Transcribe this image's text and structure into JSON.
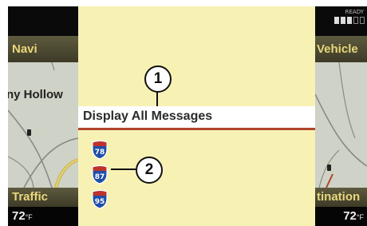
{
  "left_panel": {
    "navi_label": "Navi",
    "map_label": "ny Hollow",
    "traffic_label": "Traffic",
    "temp_value": "72",
    "temp_unit": "°F"
  },
  "right_panel": {
    "status_text": "READY",
    "vehicle_label": "Vehicle",
    "destination_label": "tination",
    "temp_value": "72",
    "temp_unit": "°F"
  },
  "overlay": {
    "message_label": "Display All Messages",
    "shields": [
      "78",
      "87",
      "95"
    ]
  },
  "callouts": {
    "one": "1",
    "two": "2"
  },
  "colors": {
    "overlay_background": "#f7f1b4",
    "softkey_text": "#e8d77a",
    "highlight_line": "#b0442a",
    "shield_blue": "#1f4fa8",
    "shield_red": "#c0322a"
  }
}
